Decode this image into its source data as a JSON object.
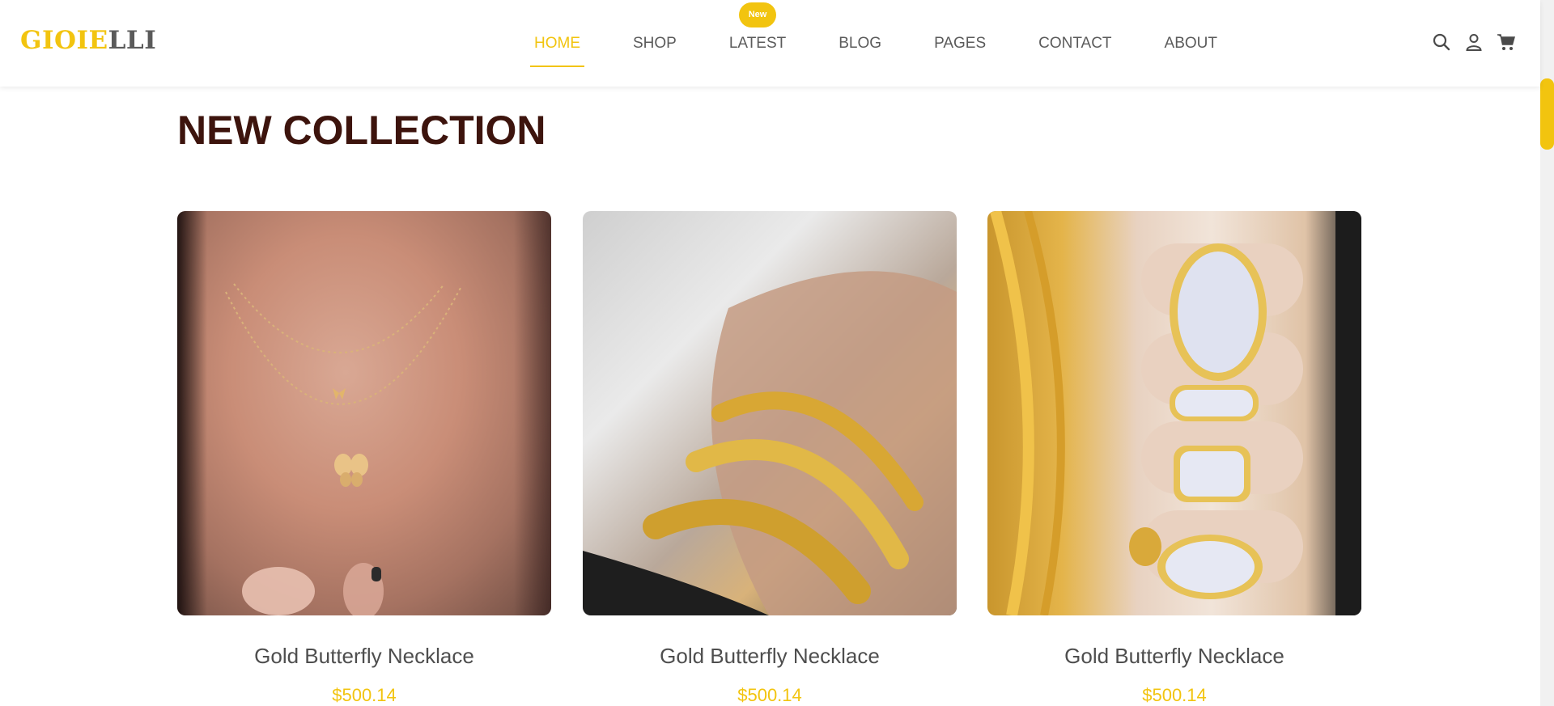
{
  "header": {
    "logo_part1": "GIOIE",
    "logo_part2": "LLI",
    "nav": [
      {
        "label": "HOME",
        "active": true
      },
      {
        "label": "SHOP"
      },
      {
        "label": "LATEST",
        "badge": "New"
      },
      {
        "label": "BLOG"
      },
      {
        "label": "PAGES"
      },
      {
        "label": "CONTACT"
      },
      {
        "label": "ABOUT"
      }
    ],
    "icons": [
      "search-icon",
      "user-icon",
      "cart-icon"
    ]
  },
  "colors": {
    "accent": "#f2c40f",
    "title": "#3d140d",
    "text": "#5b5b5b"
  },
  "section": {
    "title": "NEW COLLECTION"
  },
  "products": [
    {
      "name": "Gold Butterfly Necklace",
      "price": "$500.14",
      "image": "necklace-image"
    },
    {
      "name": "Gold Butterfly Necklace",
      "price": "$500.14",
      "image": "bracelets-image"
    },
    {
      "name": "Gold Butterfly Necklace",
      "price": "$500.14",
      "image": "rings-image"
    }
  ]
}
